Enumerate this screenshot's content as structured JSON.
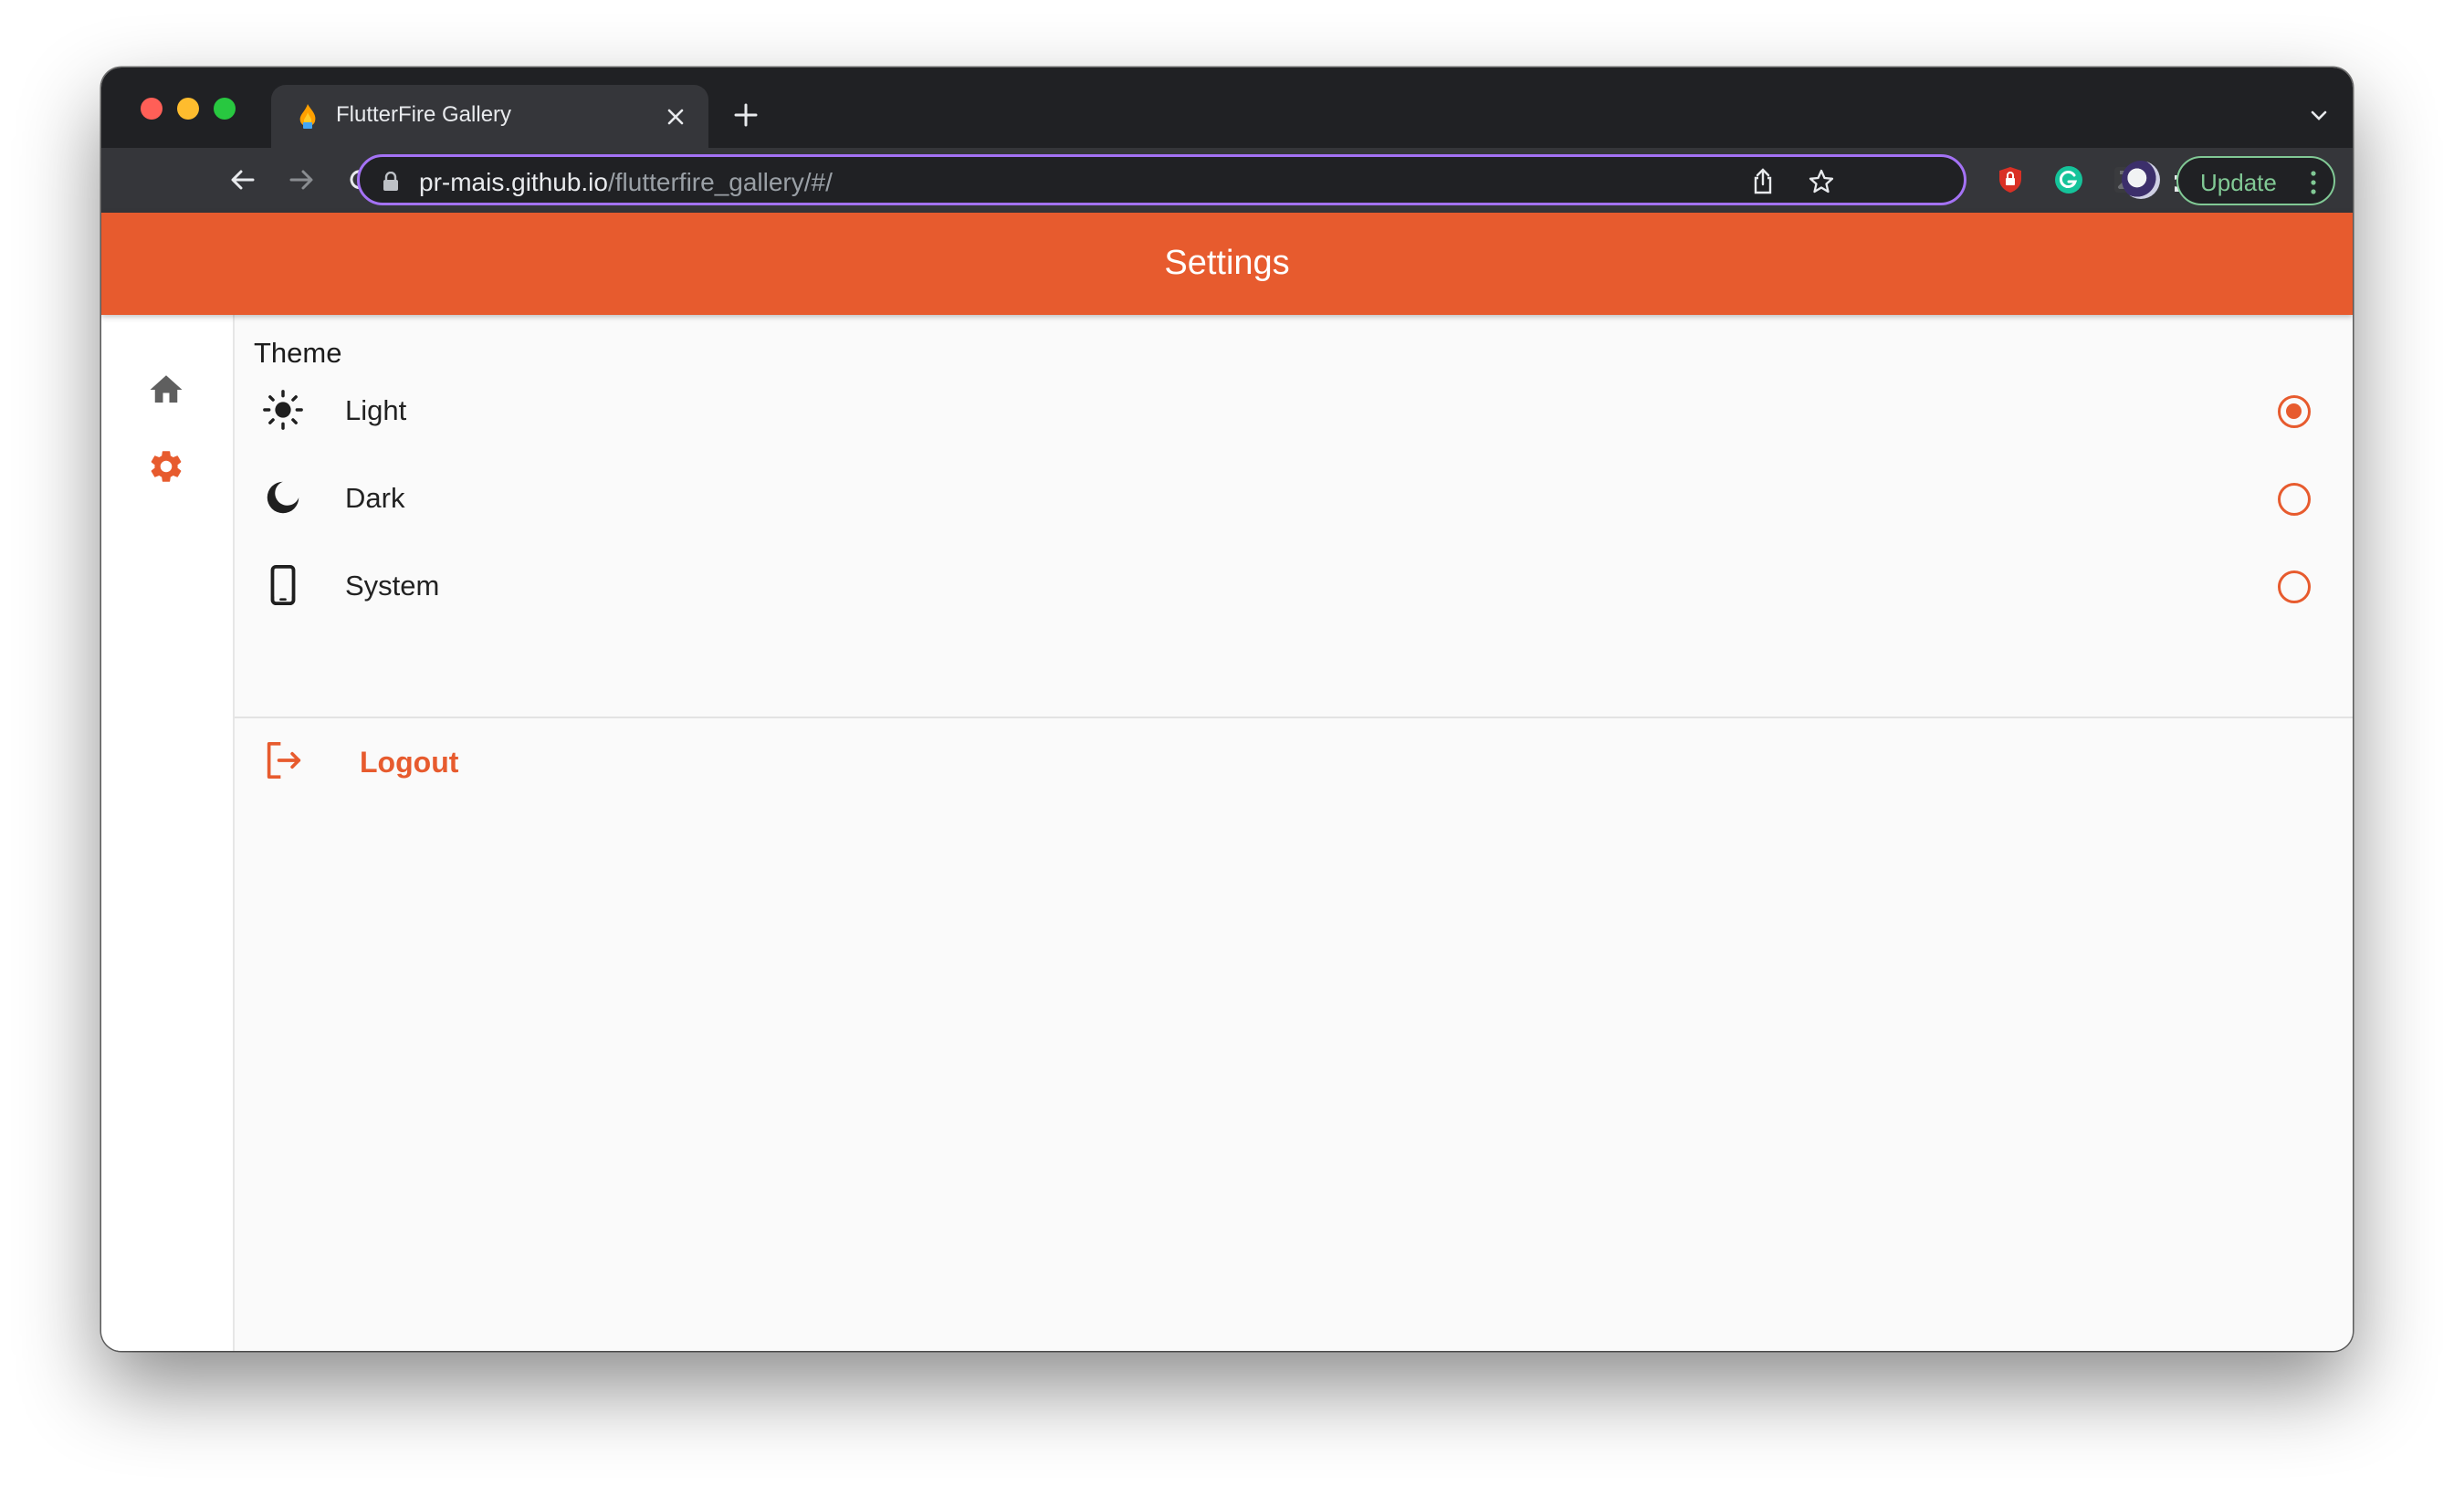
{
  "browser": {
    "tab_title": "FlutterFire Gallery",
    "url_host": "pr-mais.github.io",
    "url_path": "/flutterfire_gallery/#/",
    "update_label": "Update",
    "accent_color": "#a472f5"
  },
  "app": {
    "title": "Settings",
    "primary_color": "#e75b2e",
    "rail": [
      {
        "name": "home",
        "icon": "home-icon",
        "selected": false
      },
      {
        "name": "settings",
        "icon": "gear-icon",
        "selected": true
      }
    ],
    "theme": {
      "section_label": "Theme",
      "options": [
        {
          "label": "Light",
          "icon": "sun-icon",
          "selected": true
        },
        {
          "label": "Dark",
          "icon": "moon-icon",
          "selected": false
        },
        {
          "label": "System",
          "icon": "phone-icon",
          "selected": false
        }
      ]
    },
    "logout_label": "Logout"
  }
}
